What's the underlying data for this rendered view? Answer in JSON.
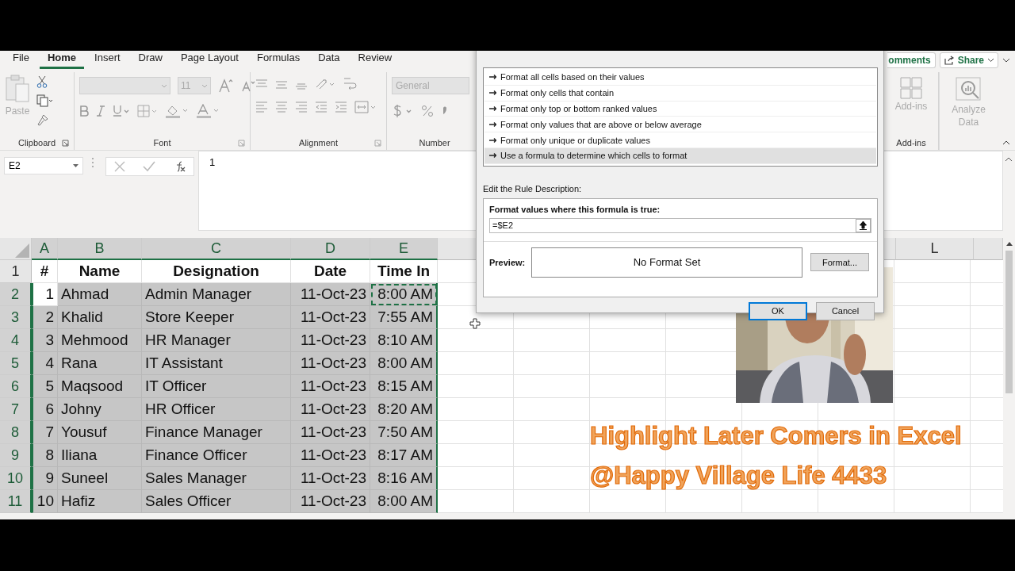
{
  "ribbon": {
    "tabs": [
      {
        "label": "File",
        "selected": false
      },
      {
        "label": "Home",
        "selected": true
      },
      {
        "label": "Insert",
        "selected": false
      },
      {
        "label": "Draw",
        "selected": false
      },
      {
        "label": "Page Layout",
        "selected": false
      },
      {
        "label": "Formulas",
        "selected": false
      },
      {
        "label": "Data",
        "selected": false
      },
      {
        "label": "Review",
        "selected": false
      }
    ],
    "comments_button": "omments",
    "share_button": "Share",
    "font_size": "11",
    "number_format": "General",
    "paste_label": "Paste",
    "addins_label": "Add-ins",
    "analyze_label": [
      "Analyze",
      "Data"
    ],
    "groups": [
      "Clipboard",
      "Font",
      "Alignment",
      "Number",
      "Add-ins"
    ]
  },
  "formula_bar": {
    "name_box": "E2",
    "value": "1"
  },
  "sheet": {
    "columns": [
      "A",
      "B",
      "C",
      "D",
      "E",
      "",
      "",
      "",
      "",
      "",
      "",
      "L",
      ""
    ],
    "rows": [
      {
        "number": "1",
        "kind": "header",
        "selected": false,
        "cells": [
          "#",
          "Name",
          "Designation",
          "Date",
          "Time In"
        ]
      },
      {
        "number": "2",
        "kind": "data",
        "selected": true,
        "active": true,
        "cells": [
          "1",
          "Ahmad",
          "Admin Manager",
          "11-Oct-23",
          "8:00 AM"
        ]
      },
      {
        "number": "3",
        "kind": "data",
        "selected": true,
        "active": false,
        "cells": [
          "2",
          "Khalid",
          "Store Keeper",
          "11-Oct-23",
          "7:55 AM"
        ]
      },
      {
        "number": "4",
        "kind": "data",
        "selected": true,
        "active": false,
        "cells": [
          "3",
          "Mehmood",
          "HR Manager",
          "11-Oct-23",
          "8:10 AM"
        ]
      },
      {
        "number": "5",
        "kind": "data",
        "selected": true,
        "active": false,
        "cells": [
          "4",
          "Rana",
          "IT Assistant",
          "11-Oct-23",
          "8:00 AM"
        ]
      },
      {
        "number": "6",
        "kind": "data",
        "selected": true,
        "active": false,
        "cells": [
          "5",
          "Maqsood",
          "IT Officer",
          "11-Oct-23",
          "8:15 AM"
        ]
      },
      {
        "number": "7",
        "kind": "data",
        "selected": true,
        "active": false,
        "cells": [
          "6",
          "Johny",
          "HR Officer",
          "11-Oct-23",
          "8:20 AM"
        ]
      },
      {
        "number": "8",
        "kind": "data",
        "selected": true,
        "active": false,
        "cells": [
          "7",
          "Yousuf",
          "Finance Manager",
          "11-Oct-23",
          "7:50 AM"
        ]
      },
      {
        "number": "9",
        "kind": "data",
        "selected": true,
        "active": false,
        "cells": [
          "8",
          "Iliana",
          "Finance Officer",
          "11-Oct-23",
          "8:17 AM"
        ]
      },
      {
        "number": "10",
        "kind": "data",
        "selected": true,
        "active": false,
        "cells": [
          "9",
          "Suneel",
          "Sales Manager",
          "11-Oct-23",
          "8:16 AM"
        ]
      },
      {
        "number": "11",
        "kind": "data",
        "selected": true,
        "active": false,
        "cells": [
          "10",
          "Hafiz",
          "Sales Officer",
          "11-Oct-23",
          "8:00 AM"
        ]
      }
    ]
  },
  "dialog": {
    "rule_types": [
      {
        "label": "Format all cells based on their values",
        "selected": false
      },
      {
        "label": "Format only cells that contain",
        "selected": false
      },
      {
        "label": "Format only top or bottom ranked values",
        "selected": false
      },
      {
        "label": "Format only values that are above or below average",
        "selected": false
      },
      {
        "label": "Format only unique or duplicate values",
        "selected": false
      },
      {
        "label": "Use a formula to determine which cells to format",
        "selected": true
      }
    ],
    "description_label": "Edit the Rule Description:",
    "formula_label": "Format values where this formula is true:",
    "formula_value": "=$E2",
    "preview_label": "Preview:",
    "preview_text": "No Format Set",
    "format_button": "Format...",
    "ok_button": "OK",
    "cancel_button": "Cancel"
  },
  "caption": [
    "Highlight Later Comers in Excel",
    "@Happy Village Life 4433"
  ]
}
